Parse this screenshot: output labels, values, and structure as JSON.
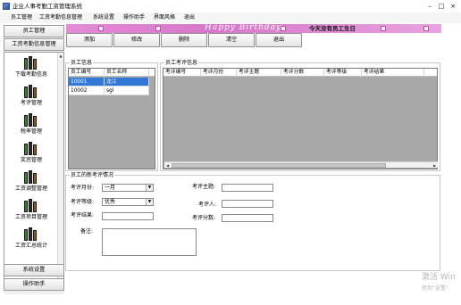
{
  "window": {
    "title": "企业人事考勤工资管理系统",
    "controls": {
      "minimize": "–",
      "maximize": "□",
      "close": "×"
    }
  },
  "menu": [
    "员工管理",
    "工资考勤信息管理",
    "系统设置",
    "操作助手",
    "界面风格",
    "退出"
  ],
  "banner": {
    "birthday_text": "Happy Birthday",
    "notice": "今天没有员工生日"
  },
  "toolbar": {
    "add": "添加",
    "edit": "修改",
    "delete": "删除",
    "clear": "清空",
    "exit": "退出"
  },
  "sidebar": {
    "top_buttons": [
      "员工管理",
      "工资考勤信息管理"
    ],
    "items": [
      "下载考勤信息",
      "考评管理",
      "税率管理",
      "奖惩管理",
      "工资调整管理",
      "工资项目管理",
      "工资汇总统计"
    ],
    "bottom_buttons": [
      "系统设置",
      "操作助手"
    ]
  },
  "employee_info": {
    "title": "员工信息",
    "columns": [
      "员工编号",
      "员工名称"
    ],
    "rows": [
      {
        "id": "10001",
        "name": "龙江",
        "selected": true
      },
      {
        "id": "10002",
        "name": "sgl",
        "selected": false
      }
    ]
  },
  "evaluation_info": {
    "title": "员工考评信息",
    "columns": [
      "考评编号",
      "考评月份",
      "考评主题",
      "考评分数",
      "考评等级",
      "考评结果"
    ]
  },
  "new_eval": {
    "title": "员工的新考评情况",
    "month_label": "考评月份:",
    "month_value": "一月",
    "subject_label": "考评主题:",
    "subject_value": "",
    "grade_label": "考评等级:",
    "grade_value": "优秀",
    "evaluator_label": "考评人:",
    "evaluator_value": "",
    "result_label": "考评结果:",
    "result_value": "",
    "score_label": "考评分数:",
    "score_value": "",
    "remarks_label": "备注:",
    "remarks_value": ""
  },
  "watermark": {
    "line1": "激活 Win",
    "line2": "转到\"设置\""
  }
}
